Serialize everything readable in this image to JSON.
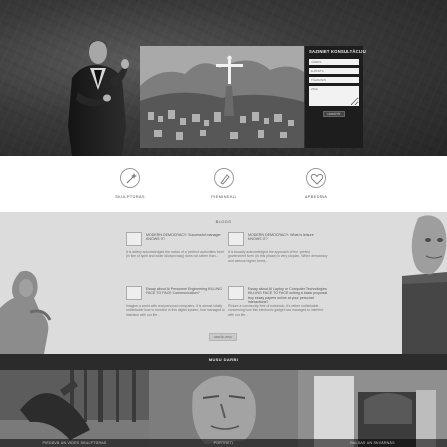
{
  "hero": {
    "form": {
      "title": "SAZINIET KONSULTĀCIJU",
      "name_placeholder": "VĀRDS",
      "email_placeholder": "E-PASTS",
      "phone_placeholder": "TĀLRUNIS",
      "message_placeholder": "ZIŅA",
      "submit_label": "NOSŪTĪT"
    }
  },
  "services": [
    {
      "label": "SKULPTŪRAS",
      "icon": "wand-icon"
    },
    {
      "label": "PIEMINEKĻI",
      "icon": "pen-icon"
    },
    {
      "label": "APBEDĪBA",
      "icon": "heart-icon"
    }
  ],
  "blog": {
    "title": "BLOGS",
    "posts": [
      {
        "title": "MODERN DEMOCRACY: Successful manager KNOWS IT!",
        "excerpt": "It is widely acknowledged the notion of a 'perfect' authorities form' (in line of spirit and wider idiosyncrasy) does not rather than..."
      },
      {
        "title": "MODERN DEMOCRACY: What is leisure KNOWS IT?",
        "excerpt": "It is broadly acknowledged the approach of the 'perfect government form' (in this phase) is very utopian. When democracy and various higher forms..."
      },
      {
        "title": "Essay about Ai Personnel Engineering KILLING FACE TO FACE Communication?",
        "excerpt": "Imagine a world with real personal computers. It is almost totally unthinkable how to function in this digital system, that managed to interface with our life..."
      },
      {
        "title": "Essay about AI Laptop or Computer Technologies KILLING FACE TO FACE writing a basic proposal. buy essay papers online at your personal interactions?",
        "excerpt": "Picture a community free of notebook. It's rather unthinkable concerning how this electronic gadget has managed to interfere with our life..."
      }
    ],
    "more_label": "VAIRĀK ZIŅU"
  },
  "works": {
    "title": "MUSU DARBI",
    "items": [
      {
        "caption": "PIEDĀVĀ UN VIDES SKULPTŪRAS"
      },
      {
        "caption": "PORTRETI"
      },
      {
        "caption": "BALSAS UN SKVĀRNĀS"
      }
    ]
  }
}
